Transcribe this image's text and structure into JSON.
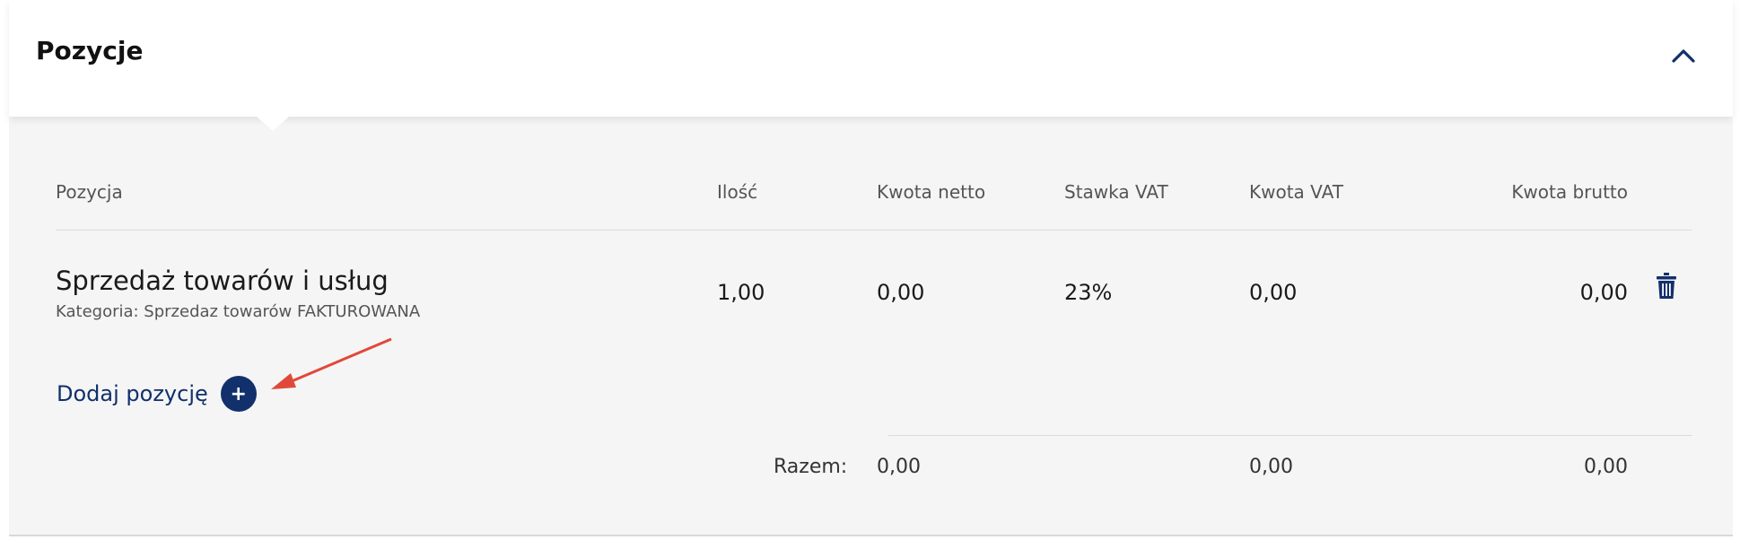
{
  "section": {
    "title": "Pozycje"
  },
  "table": {
    "headers": {
      "position": "Pozycja",
      "quantity": "Ilość",
      "net": "Kwota netto",
      "vat_rate": "Stawka VAT",
      "vat_amount": "Kwota VAT",
      "gross": "Kwota brutto"
    },
    "rows": [
      {
        "name": "Sprzedaż towarów i usług",
        "category": "Kategoria: Sprzedaz towarów FAKTUROWANA",
        "quantity": "1,00",
        "net": "0,00",
        "vat_rate": "23%",
        "vat_amount": "0,00",
        "gross": "0,00"
      }
    ],
    "add_label": "Dodaj pozycję",
    "add_icon": "+",
    "totals": {
      "label": "Razem:",
      "net": "0,00",
      "vat_amount": "0,00",
      "gross": "0,00"
    }
  },
  "icons": {
    "collapse": "chevron-up-icon",
    "delete": "trash-icon",
    "add": "plus-circle-icon"
  },
  "colors": {
    "accent": "#12306b",
    "annotation_arrow": "#e0493a",
    "panel_bg": "#f5f5f5"
  }
}
